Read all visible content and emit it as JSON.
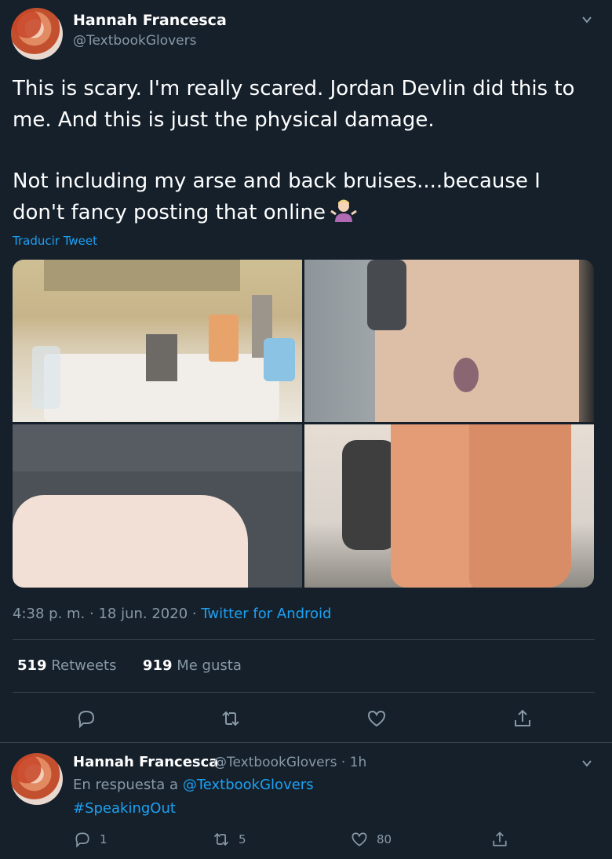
{
  "tweet": {
    "author_name": "Hannah Francesca",
    "author_handle": "@TextbookGlovers",
    "text_p1": "This is scary. I'm really scared. Jordan Devlin did this to me. And this is just the physical damage.",
    "text_p2": "Not including my arse and back bruises....because I don't fancy posting that online",
    "emoji": "person-shrugging-emoji",
    "translate_label": "Traducir Tweet",
    "time": "4:38 p. m.",
    "date": "18 jun. 2020",
    "source": "Twitter for Android",
    "retweets_count": "519",
    "retweets_label": "Retweets",
    "likes_count": "919",
    "likes_label": "Me gusta",
    "media": [
      "bathroom-sink-photo",
      "bruised-leg-photo",
      "arm-on-jeans-photo",
      "legs-bathroom-photo"
    ]
  },
  "actions": [
    "reply-icon",
    "retweet-icon",
    "like-icon",
    "share-icon"
  ],
  "reply": {
    "author_name": "Hannah Francesca",
    "author_handle": "@TextbookGlovers",
    "time_ago": "1h",
    "in_reply_prefix": "En respuesta a",
    "in_reply_handle": "@TextbookGlovers",
    "text": "#SpeakingOut",
    "reply_count": "1",
    "retweet_count": "5",
    "like_count": "80"
  },
  "colors": {
    "background": "#15202b",
    "accent": "#1da1f2",
    "muted": "#8899a6",
    "divider": "#38444d"
  }
}
